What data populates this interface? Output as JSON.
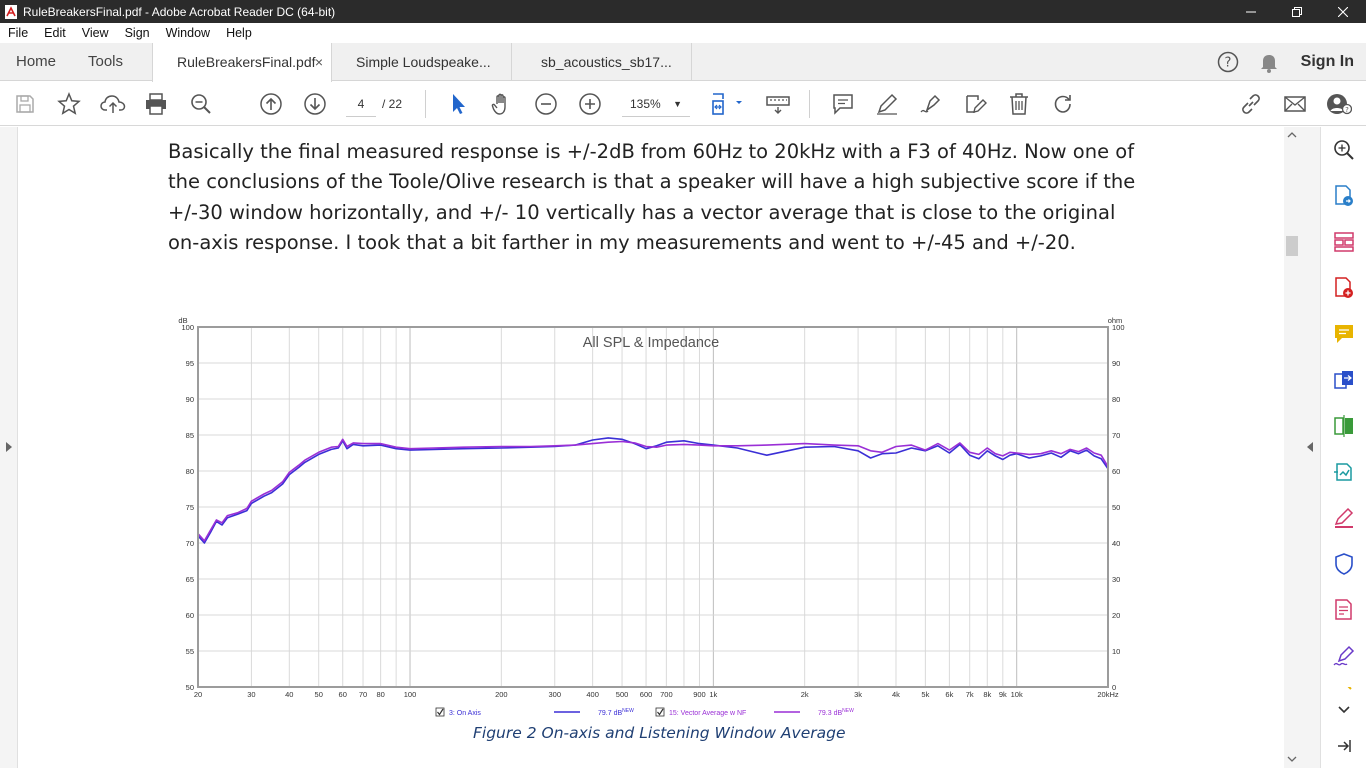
{
  "window": {
    "title": "RuleBreakersFinal.pdf - Adobe Acrobat Reader DC (64-bit)"
  },
  "menu": [
    "File",
    "Edit",
    "View",
    "Sign",
    "Window",
    "Help"
  ],
  "nav": {
    "home": "Home",
    "tools": "Tools"
  },
  "tabs": [
    {
      "label": "RuleBreakersFinal.pdf",
      "close": "×"
    },
    {
      "label": "Simple Loudspeake..."
    },
    {
      "label": "sb_acoustics_sb17..."
    }
  ],
  "header": {
    "sign_in": "Sign In"
  },
  "toolbar": {
    "page_current": "4",
    "page_total": "/ 22",
    "zoom": "135%"
  },
  "document": {
    "paragraph": "Basically the final measured response is +/-2dB from 60Hz to 20kHz with a F3 of 40Hz.  Now one of the conclusions of the Toole/Olive research is that a speaker will have a high subjective score if the +/-30 window horizontally, and +/- 10 vertically has a vector average that is close to the original on-axis response.  I took that a bit farther in my measurements and went to +/-45 and +/-20.",
    "caption": "Figure 2 On-axis and Listening Window Average"
  },
  "chart_data": {
    "type": "line",
    "title": "All SPL & Impedance",
    "xlabel": "",
    "ylabel": "dB",
    "y2label": "ohm",
    "x_scale": "log",
    "xlim": [
      20,
      20000
    ],
    "ylim": [
      50,
      100
    ],
    "y2lim": [
      0,
      100
    ],
    "grid": true,
    "x_ticks": [
      "20",
      "30",
      "40",
      "50",
      "60",
      "70",
      "80",
      "100",
      "200",
      "300",
      "400",
      "500",
      "600",
      "700",
      "900",
      "1k",
      "2k",
      "3k",
      "4k",
      "5k",
      "6k",
      "7k",
      "8k",
      "9k",
      "10k",
      "20kHz"
    ],
    "y_ticks": [
      "100",
      "95",
      "90",
      "85",
      "80",
      "75",
      "70",
      "65",
      "60",
      "55",
      "50"
    ],
    "y2_ticks": [
      "100",
      "90",
      "80",
      "70",
      "60",
      "50",
      "40",
      "30",
      "20",
      "10",
      "0"
    ],
    "legend": [
      {
        "label": "3: On Axis",
        "value": "79.7 dB",
        "sup": "NEW",
        "checked": true
      },
      {
        "label": "15: Vector Average w NF",
        "value": "79.3 dB",
        "sup": "NEW",
        "checked": true
      }
    ],
    "series": [
      {
        "color": "#3b2fd6",
        "x": [
          20,
          21,
          22,
          23,
          24,
          25,
          27,
          29,
          30,
          33,
          35,
          38,
          40,
          43,
          45,
          50,
          55,
          58,
          60,
          62,
          65,
          70,
          80,
          90,
          100,
          120,
          150,
          200,
          250,
          300,
          350,
          400,
          450,
          500,
          550,
          600,
          650,
          700,
          800,
          900,
          1000,
          1200,
          1500,
          2000,
          2500,
          3000,
          3300,
          3600,
          4000,
          4500,
          5000,
          5500,
          6000,
          6500,
          7000,
          7500,
          8000,
          8500,
          9000,
          9500,
          10000,
          11000,
          12000,
          13000,
          14000,
          15000,
          16000,
          17000,
          18000,
          19000,
          20000
        ],
        "values": [
          71,
          70,
          71.5,
          73,
          72.5,
          73.5,
          74,
          74.5,
          75.5,
          76.5,
          77,
          78.2,
          79.5,
          80.5,
          81.2,
          82.3,
          83,
          83.2,
          84.2,
          83.1,
          83.7,
          83.5,
          83.6,
          83.1,
          82.9,
          83,
          83.1,
          83.2,
          83.3,
          83.4,
          83.6,
          84.3,
          84.6,
          84.4,
          83.8,
          83.1,
          83.5,
          84,
          84.2,
          83.8,
          83.6,
          83.2,
          82.2,
          83.3,
          83.4,
          82.8,
          81.8,
          82.4,
          82.5,
          83.2,
          82.8,
          83.5,
          82.5,
          83.7,
          82.2,
          81.7,
          82.8,
          82.1,
          81.6,
          82.2,
          82.4,
          81.8,
          82.1,
          82.5,
          81.9,
          82.8,
          82.4,
          82.9,
          82.1,
          81.7,
          80.3
        ]
      },
      {
        "color": "#9a2fd6",
        "x": [
          20,
          21,
          22,
          23,
          24,
          25,
          27,
          29,
          30,
          33,
          35,
          38,
          40,
          43,
          45,
          50,
          55,
          58,
          60,
          62,
          65,
          70,
          80,
          90,
          100,
          120,
          150,
          200,
          250,
          300,
          350,
          400,
          450,
          500,
          550,
          600,
          650,
          700,
          800,
          900,
          1000,
          1200,
          1500,
          2000,
          2500,
          3000,
          3300,
          3600,
          4000,
          4500,
          5000,
          5500,
          6000,
          6500,
          7000,
          7500,
          8000,
          8500,
          9000,
          9500,
          10000,
          11000,
          12000,
          13000,
          14000,
          15000,
          16000,
          17000,
          18000,
          19000,
          20000
        ],
        "values": [
          71.3,
          70.3,
          71.8,
          73.2,
          72.8,
          73.8,
          74.2,
          74.8,
          75.8,
          76.8,
          77.3,
          78.5,
          79.8,
          80.8,
          81.5,
          82.6,
          83.3,
          83.4,
          84.4,
          83.4,
          83.9,
          83.8,
          83.8,
          83.3,
          83.1,
          83.2,
          83.3,
          83.4,
          83.4,
          83.5,
          83.6,
          83.8,
          84.0,
          84.1,
          83.9,
          83.4,
          83.3,
          83.6,
          83.7,
          83.6,
          83.5,
          83.5,
          83.6,
          83.8,
          83.6,
          83.5,
          82.8,
          82.6,
          83.4,
          83.6,
          82.9,
          83.8,
          82.9,
          83.9,
          82.6,
          82.3,
          83.2,
          82.4,
          82.1,
          82.6,
          82.5,
          82.3,
          82.4,
          82.8,
          82.4,
          83.0,
          82.7,
          83.2,
          82.5,
          82.2,
          80.6
        ]
      }
    ]
  }
}
